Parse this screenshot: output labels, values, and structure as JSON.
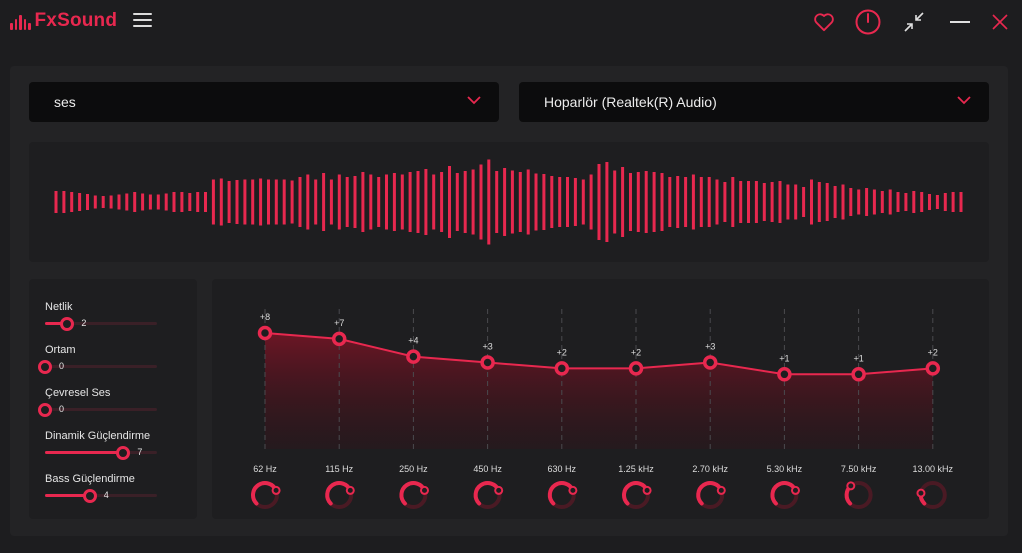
{
  "app": {
    "name": "FxSound"
  },
  "colors": {
    "accent": "#e8284f",
    "background": "#1d1d1f",
    "panel": "#1e1e20",
    "dropdown": "#0c0c0d"
  },
  "titlebar": {
    "icons": [
      "menu-icon",
      "heart-icon",
      "power-icon",
      "minimize-window-icon",
      "minimize-icon",
      "close-icon"
    ]
  },
  "preset_dropdown": {
    "value": "ses"
  },
  "device_dropdown": {
    "value": "Hoparlör (Realtek(R) Audio)"
  },
  "visualizer": {
    "levels": [
      0.22,
      0.22,
      0.2,
      0.18,
      0.16,
      0.13,
      0.12,
      0.13,
      0.15,
      0.17,
      0.2,
      0.17,
      0.15,
      0.15,
      0.17,
      0.2,
      0.2,
      0.18,
      0.2,
      0.2,
      0.45,
      0.47,
      0.42,
      0.44,
      0.45,
      0.45,
      0.47,
      0.45,
      0.45,
      0.45,
      0.43,
      0.5,
      0.55,
      0.45,
      0.58,
      0.45,
      0.55,
      0.5,
      0.52,
      0.6,
      0.55,
      0.5,
      0.55,
      0.58,
      0.55,
      0.6,
      0.62,
      0.66,
      0.55,
      0.6,
      0.72,
      0.58,
      0.62,
      0.65,
      0.75,
      0.85,
      0.62,
      0.68,
      0.63,
      0.6,
      0.65,
      0.57,
      0.56,
      0.52,
      0.5,
      0.5,
      0.48,
      0.45,
      0.55,
      0.76,
      0.8,
      0.63,
      0.7,
      0.58,
      0.6,
      0.62,
      0.6,
      0.58,
      0.5,
      0.52,
      0.5,
      0.55,
      0.5,
      0.5,
      0.45,
      0.4,
      0.5,
      0.42,
      0.42,
      0.42,
      0.38,
      0.4,
      0.42,
      0.35,
      0.35,
      0.3,
      0.45,
      0.4,
      0.38,
      0.32,
      0.35,
      0.28,
      0.25,
      0.28,
      0.25,
      0.22,
      0.25,
      0.2,
      0.18,
      0.22,
      0.2,
      0.16,
      0.14,
      0.18,
      0.2,
      0.2
    ]
  },
  "effects": [
    {
      "label": "Netlik",
      "value": "2",
      "level": 0.2
    },
    {
      "label": "Ortam",
      "value": "0",
      "level": 0.0
    },
    {
      "label": "Çevresel Ses",
      "value": "0",
      "level": 0.0
    },
    {
      "label": "Dinamik Güçlendirme",
      "value": "7",
      "level": 0.7
    },
    {
      "label": "Bass Güçlendirme",
      "value": "4",
      "level": 0.4
    }
  ],
  "equalizer": {
    "bands": [
      {
        "freq": "62 Hz",
        "gain_label": "+8",
        "gain": 8,
        "knob_level": 0.75
      },
      {
        "freq": "115 Hz",
        "gain_label": "+7",
        "gain": 7,
        "knob_level": 0.75
      },
      {
        "freq": "250 Hz",
        "gain_label": "+4",
        "gain": 4,
        "knob_level": 0.75
      },
      {
        "freq": "450 Hz",
        "gain_label": "+3",
        "gain": 3,
        "knob_level": 0.75
      },
      {
        "freq": "630 Hz",
        "gain_label": "+2",
        "gain": 2,
        "knob_level": 0.75
      },
      {
        "freq": "1.25 kHz",
        "gain_label": "+2",
        "gain": 2,
        "knob_level": 0.75
      },
      {
        "freq": "2.70 kHz",
        "gain_label": "+3",
        "gain": 3,
        "knob_level": 0.75
      },
      {
        "freq": "5.30 kHz",
        "gain_label": "+1",
        "gain": 1,
        "knob_level": 0.75
      },
      {
        "freq": "7.50 kHz",
        "gain_label": "+1",
        "gain": 1,
        "knob_level": 0.35
      },
      {
        "freq": "13.00 kHz",
        "gain_label": "+2",
        "gain": 2,
        "knob_level": 0.2
      }
    ]
  }
}
